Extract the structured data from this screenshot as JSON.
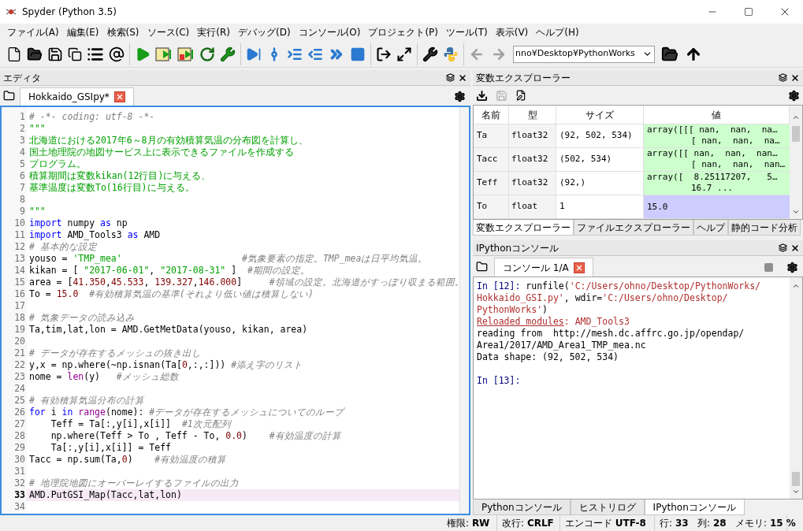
{
  "window": {
    "title": "Spyder (Python 3.5)"
  },
  "menu": [
    "ファイル(A)",
    "編集(E)",
    "検索(S)",
    "ソース(C)",
    "実行(R)",
    "デバッグ(D)",
    "コンソール(O)",
    "プロジェクト(P)",
    "ツール(T)",
    "表示(V)",
    "ヘルプ(H)"
  ],
  "toolbar": {
    "path": "nno¥Desktop¥PythonWorks"
  },
  "editor": {
    "title": "エディタ",
    "tab": "Hokkaido_GSIpy*",
    "lines": [
      {
        "no": "1",
        "current": false,
        "tokens": [
          {
            "kind": "c",
            "text": "# -*- coding: utf-8 -*-"
          }
        ]
      },
      {
        "no": "2",
        "current": false,
        "tokens": [
          {
            "kind": "d",
            "text": "\"\"\""
          }
        ]
      },
      {
        "no": "3",
        "current": false,
        "tokens": [
          {
            "kind": "d",
            "text": "北海道における2017年6～8月の有効積算気温の分布図を計算し、"
          }
        ]
      },
      {
        "no": "4",
        "current": false,
        "tokens": [
          {
            "kind": "d",
            "text": "国土地理院の地図サービス上に表示できるファイルを作成する"
          }
        ]
      },
      {
        "no": "5",
        "current": false,
        "tokens": [
          {
            "kind": "d",
            "text": "プログラム。"
          }
        ]
      },
      {
        "no": "6",
        "current": false,
        "tokens": [
          {
            "kind": "d",
            "text": "積算期間は変数kikan(12行目)に与える、"
          }
        ]
      },
      {
        "no": "7",
        "current": false,
        "tokens": [
          {
            "kind": "d",
            "text": "基準温度は変数To(16行目)に与える。"
          }
        ]
      },
      {
        "no": "8",
        "current": false
      },
      {
        "no": "9",
        "current": false,
        "tokens": [
          {
            "kind": "d",
            "text": "\"\"\""
          }
        ]
      },
      {
        "no": "10",
        "current": false,
        "tokens": [
          {
            "kind": "k",
            "text": "import"
          },
          {
            "kind": "p",
            "text": " numpy "
          },
          {
            "kind": "k",
            "text": "as"
          },
          {
            "kind": "p",
            "text": " np"
          }
        ]
      },
      {
        "no": "11",
        "current": false,
        "tokens": [
          {
            "kind": "k",
            "text": "import"
          },
          {
            "kind": "p",
            "text": " AMD_Tools3 "
          },
          {
            "kind": "k",
            "text": "as"
          },
          {
            "kind": "p",
            "text": " AMD"
          }
        ]
      },
      {
        "no": "12",
        "current": false,
        "tokens": [
          {
            "kind": "c",
            "text": "# 基本的な設定"
          }
        ]
      },
      {
        "no": "13",
        "current": false,
        "tokens": [
          {
            "kind": "p",
            "text": "youso = "
          },
          {
            "kind": "s",
            "text": "'TMP_mea'"
          },
          {
            "kind": "c",
            "text": "                      #気象要素の指定。TMP_meaは日平均気温。"
          }
        ]
      },
      {
        "no": "14",
        "current": false,
        "tokens": [
          {
            "kind": "p",
            "text": "kikan = [ "
          },
          {
            "kind": "s",
            "text": "\"2017-06-01\""
          },
          {
            "kind": "p",
            "text": ", "
          },
          {
            "kind": "s",
            "text": "\"2017-08-31\""
          },
          {
            "kind": "p",
            "text": " ]  "
          },
          {
            "kind": "c",
            "text": "#期間の設定。"
          }
        ]
      },
      {
        "no": "15",
        "current": false,
        "tokens": [
          {
            "kind": "p",
            "text": "area = ["
          },
          {
            "kind": "n",
            "text": "41.350"
          },
          {
            "kind": "p",
            "text": ","
          },
          {
            "kind": "n",
            "text": "45.533"
          },
          {
            "kind": "p",
            "text": ", "
          },
          {
            "kind": "n",
            "text": "139.327"
          },
          {
            "kind": "p",
            "text": ","
          },
          {
            "kind": "n",
            "text": "146.000"
          },
          {
            "kind": "p",
            "text": "]     "
          },
          {
            "kind": "c",
            "text": "#領域の設定。北海道がすっぽり収まる範囲。"
          }
        ]
      },
      {
        "no": "16",
        "current": false,
        "tokens": [
          {
            "kind": "p",
            "text": "To = "
          },
          {
            "kind": "n",
            "text": "15.0"
          },
          {
            "kind": "c",
            "text": "  #有効積算気温の基準(それより低い値は積算しない)"
          }
        ]
      },
      {
        "no": "17",
        "current": false
      },
      {
        "no": "18",
        "current": false,
        "tokens": [
          {
            "kind": "c",
            "text": "# 気象データの読み込み"
          }
        ]
      },
      {
        "no": "19",
        "current": false,
        "tokens": [
          {
            "kind": "p",
            "text": "Ta,tim,lat,lon = AMD.GetMetData(youso, kikan, area)"
          }
        ]
      },
      {
        "no": "20",
        "current": false
      },
      {
        "no": "21",
        "current": false,
        "tokens": [
          {
            "kind": "c",
            "text": "# データが存在するメッシュの抜き出し"
          }
        ]
      },
      {
        "no": "22",
        "current": false,
        "tokens": [
          {
            "kind": "p",
            "text": "y,x = np.where(~np.isnan(Ta["
          },
          {
            "kind": "n",
            "text": "0"
          },
          {
            "kind": "p",
            "text": ",:,:])) "
          },
          {
            "kind": "c",
            "text": "#添え字のリスト"
          }
        ]
      },
      {
        "no": "23",
        "current": false,
        "tokens": [
          {
            "kind": "p",
            "text": "nome = "
          },
          {
            "kind": "b",
            "text": "len"
          },
          {
            "kind": "p",
            "text": "(y)   "
          },
          {
            "kind": "c",
            "text": "#メッシュ総数"
          }
        ]
      },
      {
        "no": "24",
        "current": false
      },
      {
        "no": "25",
        "current": false,
        "tokens": [
          {
            "kind": "c",
            "text": "# 有効積算気温分布の計算"
          }
        ]
      },
      {
        "no": "26",
        "current": false,
        "tokens": [
          {
            "kind": "k",
            "text": "for"
          },
          {
            "kind": "p",
            "text": " i "
          },
          {
            "kind": "k",
            "text": "in"
          },
          {
            "kind": "b",
            "text": " range"
          },
          {
            "kind": "p",
            "text": "(nome): "
          },
          {
            "kind": "c",
            "text": "#データが存在するメッシュについてのループ"
          }
        ]
      },
      {
        "no": "27",
        "current": false,
        "tokens": [
          {
            "kind": "p",
            "text": "    Teff = Ta[:,y[i],x[i]]  "
          },
          {
            "kind": "c",
            "text": "#1次元配列"
          }
        ]
      },
      {
        "no": "28",
        "current": false,
        "tokens": [
          {
            "kind": "p",
            "text": "    np.where(Teff > To , Teff - To, "
          },
          {
            "kind": "n",
            "text": "0.0"
          },
          {
            "kind": "p",
            "text": ")    "
          },
          {
            "kind": "c",
            "text": "#有効温度の計算"
          }
        ]
      },
      {
        "no": "29",
        "current": false,
        "tokens": [
          {
            "kind": "p",
            "text": "    Ta[:,y[i],x[i]] = Teff"
          }
        ]
      },
      {
        "no": "30",
        "current": false,
        "tokens": [
          {
            "kind": "p",
            "text": "Tacc = np.sum(Ta,"
          },
          {
            "kind": "n",
            "text": "0"
          },
          {
            "kind": "p",
            "text": ")    "
          },
          {
            "kind": "c",
            "text": "#有効温度の積算"
          }
        ]
      },
      {
        "no": "31",
        "current": false
      },
      {
        "no": "32",
        "current": false,
        "tokens": [
          {
            "kind": "c",
            "text": "# 地理院地図にオーバーレイするファイルの出力"
          }
        ]
      },
      {
        "no": "33",
        "current": true,
        "tokens": [
          {
            "kind": "p",
            "text": "AMD.PutGSI_Map(Tacc,lat,lon)"
          }
        ]
      },
      {
        "no": "34",
        "current": false
      }
    ]
  },
  "variables": {
    "title": "変数エクスプローラー",
    "columns": [
      "名前",
      "型",
      "サイズ",
      "値"
    ],
    "rows": [
      {
        "name": "Ta",
        "type": "float32",
        "size": "(92, 502, 534)",
        "value": [
          "array([[[ nan,  nan,  na…",
          "[ nan,  nan,  na…"
        ],
        "color": "#ccffcc"
      },
      {
        "name": "Tacc",
        "type": "float32",
        "size": "(502, 534)",
        "value": [
          "array([[ nan,  nan,  nan…",
          "[ nan,  nan,  nan…"
        ],
        "color": "#ccffcc"
      },
      {
        "name": "Teff",
        "type": "float32",
        "size": "(92,)",
        "value": [
          "array([  8.25117207,   5…",
          "16.7 ..."
        ],
        "color": "#ccffcc"
      },
      {
        "name": "To",
        "type": "float",
        "size": "1",
        "value": [
          "15.0"
        ],
        "color": "#ccccff"
      }
    ],
    "tabs": [
      {
        "label": "変数エクスプローラー",
        "selected": true
      },
      {
        "label": "ファイルエクスプローラー",
        "selected": false
      },
      {
        "label": "ヘルプ",
        "selected": false
      },
      {
        "label": "静的コード分析",
        "selected": false
      }
    ]
  },
  "console": {
    "title": "IPythonコンソール",
    "tab": "コンソール 1/A",
    "lines": [
      [
        {
          "kind": "prompt",
          "text": "In [12]:"
        },
        {
          "kind": "p",
          "text": " runfile("
        },
        {
          "kind": "red",
          "text": "'C:/Users/ohno/Desktop/PythonWorks/"
        }
      ],
      [
        {
          "kind": "red",
          "text": "Hokkaido_GSI.py'"
        },
        {
          "kind": "p",
          "text": ", wdir="
        },
        {
          "kind": "red",
          "text": "'C:/Users/ohno/Desktop/"
        }
      ],
      [
        {
          "kind": "red",
          "text": "PythonWorks'"
        },
        {
          "kind": "p",
          "text": ")"
        }
      ],
      [
        {
          "kind": "link",
          "text": "Reloaded modules"
        },
        {
          "kind": "red",
          "text": ": AMD_Tools3"
        }
      ],
      [
        {
          "kind": "p",
          "text": "reading from  http://mesh.dc.affrc.go.jp/opendap/"
        }
      ],
      [
        {
          "kind": "p",
          "text": "Area1/2017/AMD_Area1_TMP_mea.nc"
        }
      ],
      [
        {
          "kind": "p",
          "text": "Data shape: (92, 502, 534)"
        }
      ]
    ],
    "prompt": "In [13]:",
    "tabs": [
      {
        "label": "Pythonコンソール",
        "selected": false
      },
      {
        "label": "ヒストリログ",
        "selected": false
      },
      {
        "label": "IPythonコンソール",
        "selected": true
      }
    ]
  },
  "status_bar": [
    {
      "label": "権限:",
      "value": "RW"
    },
    {
      "label": "改行:",
      "value": "CRLF"
    },
    {
      "label": "エンコード",
      "value": "UTF-8"
    },
    {
      "label": "行:",
      "value": "33"
    },
    {
      "label": "列:",
      "value": "28"
    },
    {
      "label": "メモリ:",
      "value": "15 %"
    }
  ]
}
